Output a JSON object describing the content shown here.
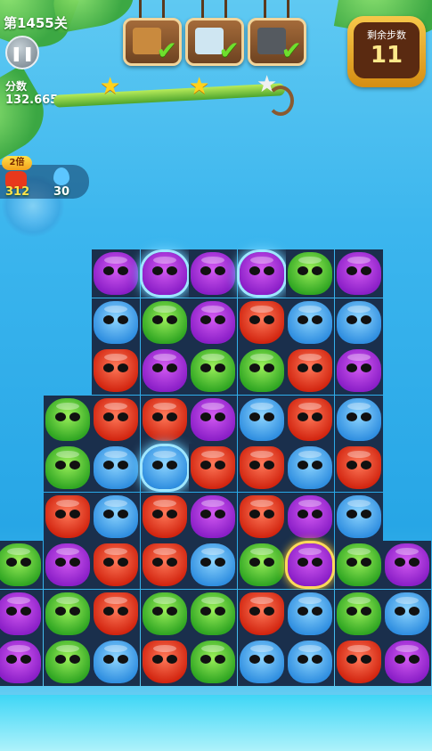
{
  "hud": {
    "level": "第1455关",
    "score_label": "分数",
    "score_value": "132.665",
    "pause_icon": "pause-icon"
  },
  "goals": [
    {
      "name": "crate-goal",
      "color": "#c98a3e",
      "done": true
    },
    {
      "name": "ice-goal",
      "color": "#cfe6f2",
      "done": true
    },
    {
      "name": "rock-goal",
      "color": "#555a60",
      "done": true
    }
  ],
  "moves": {
    "label": "剩余步数",
    "value": "11"
  },
  "booster": {
    "multiplier": "2倍",
    "left_count": "312",
    "right_count": "30"
  },
  "colors": {
    "purple": "#a63be0",
    "blue": "#4aa8f0",
    "green": "#45c232",
    "red": "#e8381c"
  },
  "board": {
    "rows": [
      [
        "",
        "",
        "P",
        "P",
        "P",
        "P",
        "G",
        "P",
        ""
      ],
      [
        "",
        "",
        "B",
        "G",
        "P",
        "R",
        "B",
        "B",
        ""
      ],
      [
        "",
        "",
        "R",
        "P",
        "G",
        "G",
        "R",
        "P",
        ""
      ],
      [
        "",
        "G",
        "R",
        "R",
        "P",
        "B",
        "R",
        "B",
        ""
      ],
      [
        "",
        "G",
        "B",
        "B",
        "R",
        "R",
        "B",
        "R",
        ""
      ],
      [
        "",
        "R",
        "B",
        "R",
        "P",
        "R",
        "P",
        "B",
        ""
      ],
      [
        "G",
        "P",
        "R",
        "R",
        "B",
        "G",
        "P",
        "G",
        "P"
      ],
      [
        "P",
        "G",
        "R",
        "G",
        "G",
        "R",
        "B",
        "G",
        "B"
      ],
      [
        "P",
        "G",
        "B",
        "R",
        "G",
        "B",
        "B",
        "R",
        "P"
      ]
    ],
    "selected": [
      [
        0,
        3
      ],
      [
        0,
        5
      ],
      [
        4,
        3
      ]
    ],
    "golden": [
      [
        6,
        6
      ]
    ]
  }
}
